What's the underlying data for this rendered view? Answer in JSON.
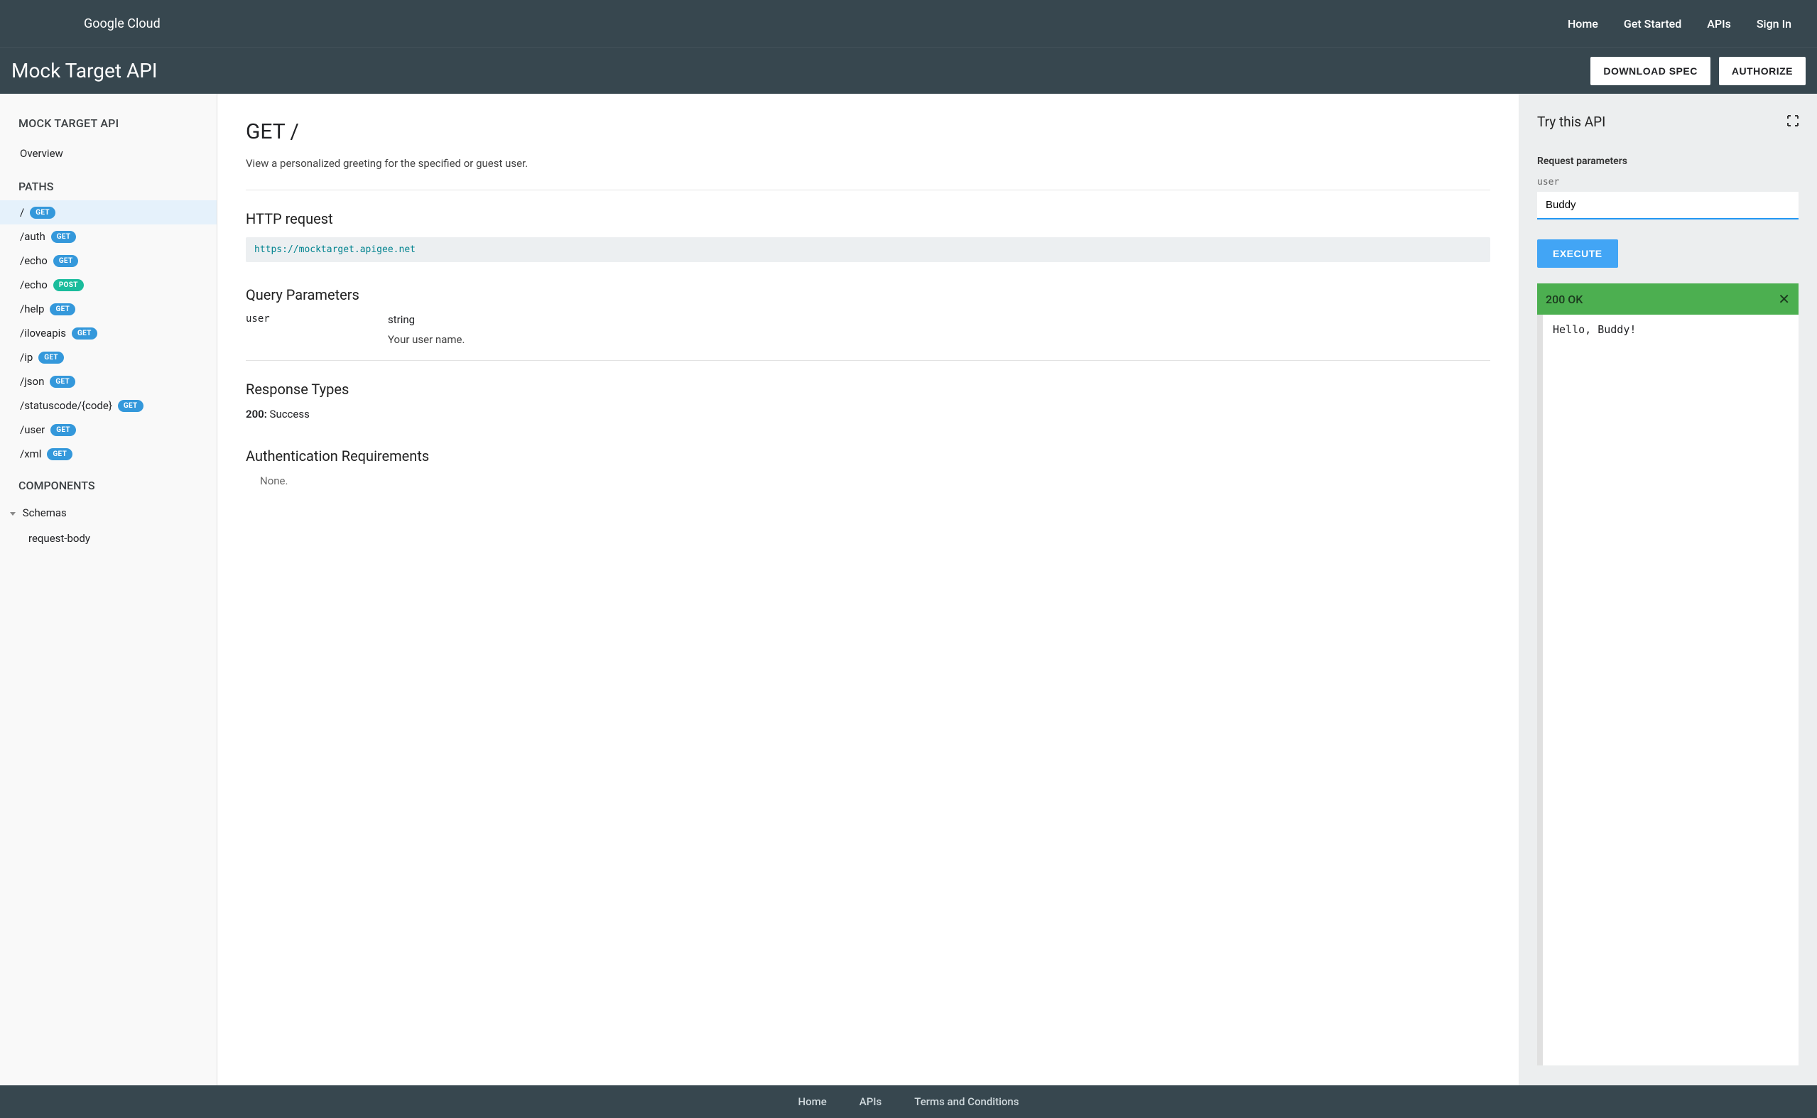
{
  "brand": {
    "logo_text": "Google Cloud"
  },
  "topnav": {
    "home": "Home",
    "get_started": "Get Started",
    "apis": "APIs",
    "sign_in": "Sign In"
  },
  "subheader": {
    "title": "Mock Target API",
    "download": "DOWNLOAD SPEC",
    "authorize": "AUTHORIZE"
  },
  "sidebar": {
    "api_heading": "MOCK TARGET API",
    "overview": "Overview",
    "paths_heading": "PATHS",
    "paths": [
      {
        "path": "/",
        "method": "GET"
      },
      {
        "path": "/auth",
        "method": "GET"
      },
      {
        "path": "/echo",
        "method": "GET"
      },
      {
        "path": "/echo",
        "method": "POST"
      },
      {
        "path": "/help",
        "method": "GET"
      },
      {
        "path": "/iloveapis",
        "method": "GET"
      },
      {
        "path": "/ip",
        "method": "GET"
      },
      {
        "path": "/json",
        "method": "GET"
      },
      {
        "path": "/statuscode/{code}",
        "method": "GET"
      },
      {
        "path": "/user",
        "method": "GET"
      },
      {
        "path": "/xml",
        "method": "GET"
      }
    ],
    "components_heading": "COMPONENTS",
    "schemas_label": "Schemas",
    "schema_item": "request-body"
  },
  "content": {
    "title": "GET /",
    "description": "View a personalized greeting for the specified or guest user.",
    "http_heading": "HTTP request",
    "http_url": "https://mocktarget.apigee.net",
    "query_heading": "Query Parameters",
    "param_name": "user",
    "param_type": "string",
    "param_desc": "Your user name.",
    "response_heading": "Response Types",
    "response_code": "200:",
    "response_text": "Success",
    "auth_heading": "Authentication Requirements",
    "auth_value": "None."
  },
  "rightpanel": {
    "title": "Try this API",
    "req_label": "Request parameters",
    "param_label": "user",
    "param_value": "Buddy",
    "execute": "EXECUTE",
    "status": "200 OK",
    "response": "Hello, Buddy!"
  },
  "footer": {
    "home": "Home",
    "apis": "APIs",
    "terms": "Terms and Conditions"
  }
}
